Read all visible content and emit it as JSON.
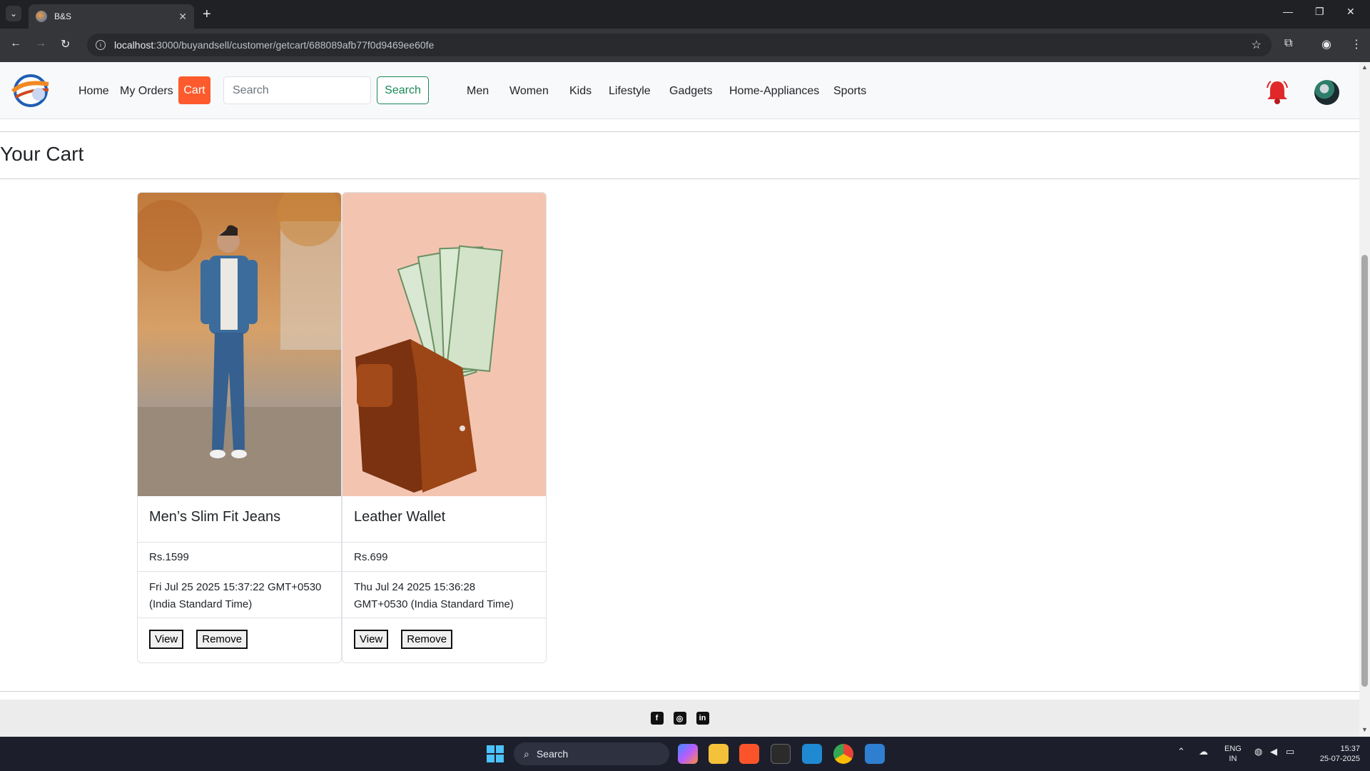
{
  "browser": {
    "tab_title": "B&S",
    "url_host": "localhost",
    "url_rest": ":3000/buyandsell/customer/getcart/688089afb77f0d9469ee60fe"
  },
  "nav": {
    "links": [
      "Home",
      "My Orders"
    ],
    "cart": "Cart",
    "search_placeholder": "Search",
    "search_button": "Search",
    "categories": [
      "Men",
      "Women",
      "Kids",
      "Lifestyle",
      "Gadgets",
      "Home-Appliances",
      "Sports"
    ],
    "accent": "#fd5b2d"
  },
  "page": {
    "title": "Your Cart"
  },
  "cart_items": [
    {
      "name": "Men’s Slim Fit Jeans",
      "price": "Rs.1599",
      "date_line1": "Fri Jul 25 2025 15:37:22 GMT+0530",
      "date_line2": "(India Standard Time)",
      "view": "View",
      "remove": "Remove"
    },
    {
      "name": "Leather Wallet",
      "price": "Rs.699",
      "date_line1": "Thu Jul 24 2025 15:36:28",
      "date_line2": "GMT+0530 (India Standard Time)",
      "view": "View",
      "remove": "Remove"
    }
  ],
  "footer_icons": [
    "facebook-icon",
    "instagram-icon",
    "linkedin-icon"
  ],
  "taskbar": {
    "search": "Search",
    "lang": "ENG",
    "region": "IN",
    "time": "15:37",
    "date": "25-07-2025"
  }
}
